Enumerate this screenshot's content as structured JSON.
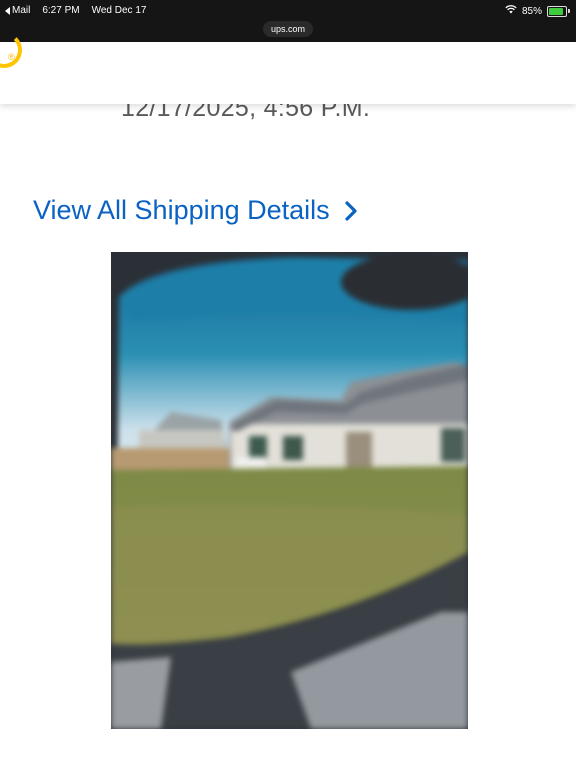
{
  "status_bar": {
    "back_app": "Mail",
    "time": "6:27 PM",
    "date": "Wed Dec 17",
    "battery": "85%",
    "battery_level": 0.85,
    "url": "ups.com"
  },
  "header": {
    "logo_mark": "®"
  },
  "content": {
    "delivery_datetime": "12/17/2025, 4:56 P.M.",
    "view_details_link": "View All Shipping Details",
    "photo_icon": "delivery-photo"
  },
  "colors": {
    "link": "#0a62c3",
    "brand_gold": "#ffc400",
    "text_gray": "#5a5a5a"
  }
}
